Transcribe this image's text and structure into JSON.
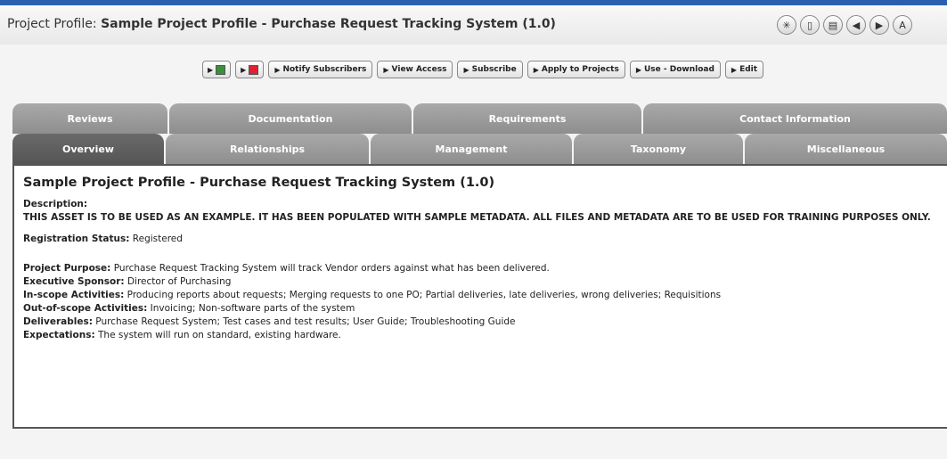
{
  "header": {
    "prefix": "Project Profile:",
    "title": "Sample Project Profile - Purchase Request Tracking System (1.0)",
    "icons": [
      "help-icon",
      "clipboard-icon",
      "print-icon",
      "back-icon",
      "forward-icon",
      "close-icon"
    ],
    "icon_glyphs": [
      "✳",
      "▯",
      "▤",
      "◀",
      "▶",
      "A"
    ]
  },
  "actions": [
    {
      "name": "excel-export-button",
      "label": "",
      "icon": "excel-icon"
    },
    {
      "name": "pdf-export-button",
      "label": "",
      "icon": "pdf-icon"
    },
    {
      "name": "notify-subscribers-button",
      "label": "Notify Subscribers"
    },
    {
      "name": "view-access-button",
      "label": "View Access"
    },
    {
      "name": "subscribe-button",
      "label": "Subscribe"
    },
    {
      "name": "apply-to-projects-button",
      "label": "Apply to Projects"
    },
    {
      "name": "use-download-button",
      "label": "Use - Download"
    },
    {
      "name": "edit-button",
      "label": "Edit"
    }
  ],
  "tabs_row1": [
    "Reviews",
    "Documentation",
    "Requirements",
    "Contact Information"
  ],
  "tabs_row2": [
    "Overview",
    "Relationships",
    "Management",
    "Taxonomy",
    "Miscellaneous"
  ],
  "active_tab": "Overview",
  "content": {
    "heading": "Sample Project Profile - Purchase Request Tracking System (1.0)",
    "description_label": "Description:",
    "description": "THIS ASSET IS TO BE USED AS AN EXAMPLE. IT HAS BEEN POPULATED WITH SAMPLE METADATA. ALL FILES AND METADATA ARE TO BE USED FOR TRAINING PURPOSES ONLY.",
    "registration_label": "Registration Status:",
    "registration_value": "Registered",
    "fields": [
      {
        "label": "Project Purpose:",
        "value": "Purchase Request Tracking System will track Vendor orders against what has been delivered."
      },
      {
        "label": "Executive Sponsor:",
        "value": "Director of Purchasing"
      },
      {
        "label": "In-scope Activities:",
        "value": "Producing reports about requests; Merging requests to one PO; Partial deliveries, late deliveries, wrong deliveries; Requisitions"
      },
      {
        "label": "Out-of-scope Activities:",
        "value": "Invoicing; Non-software parts of the system"
      },
      {
        "label": "Deliverables:",
        "value": "Purchase Request System; Test cases and test results; User Guide; Troubleshooting Guide"
      },
      {
        "label": "Expectations:",
        "value": "The system will run on standard, existing hardware."
      }
    ]
  }
}
